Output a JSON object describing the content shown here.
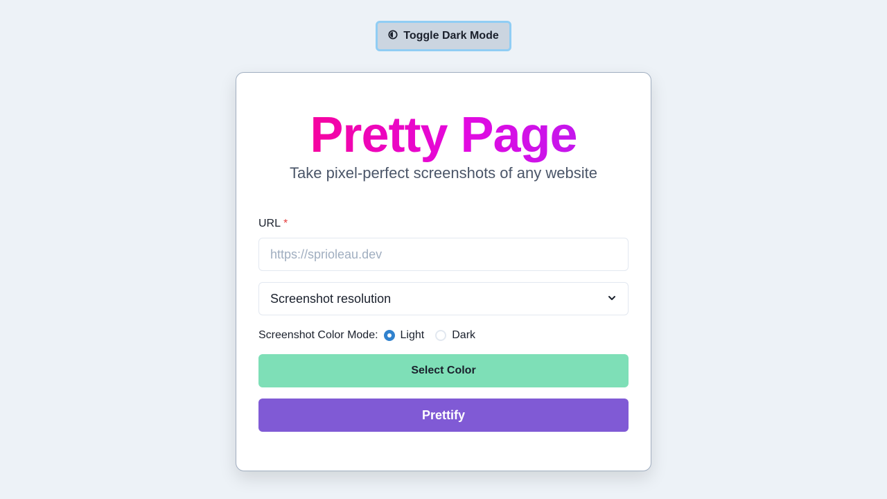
{
  "header": {
    "toggle_label": "Toggle Dark Mode",
    "toggle_icon": "contrast-icon"
  },
  "card": {
    "title": "Pretty Page",
    "subtitle": "Take pixel-perfect screenshots of any website"
  },
  "form": {
    "url_label": "URL",
    "url_required_marker": "*",
    "url_placeholder": "https://sprioleau.dev",
    "url_value": "",
    "resolution_select": "Screenshot resolution",
    "color_mode_label": "Screenshot Color Mode:",
    "color_mode_options": [
      {
        "label": "Light",
        "checked": true
      },
      {
        "label": "Dark",
        "checked": false
      }
    ],
    "select_color_label": "Select Color",
    "prettify_label": "Prettify"
  },
  "colors": {
    "background": "#edf2f7",
    "title_gradient_start": "#ff0080",
    "title_gradient_end": "#b01ff5",
    "select_color_button": "#7edfb7",
    "prettify_button": "#805ad5",
    "radio_checked": "#3182ce",
    "required_marker": "#e53e3e"
  }
}
